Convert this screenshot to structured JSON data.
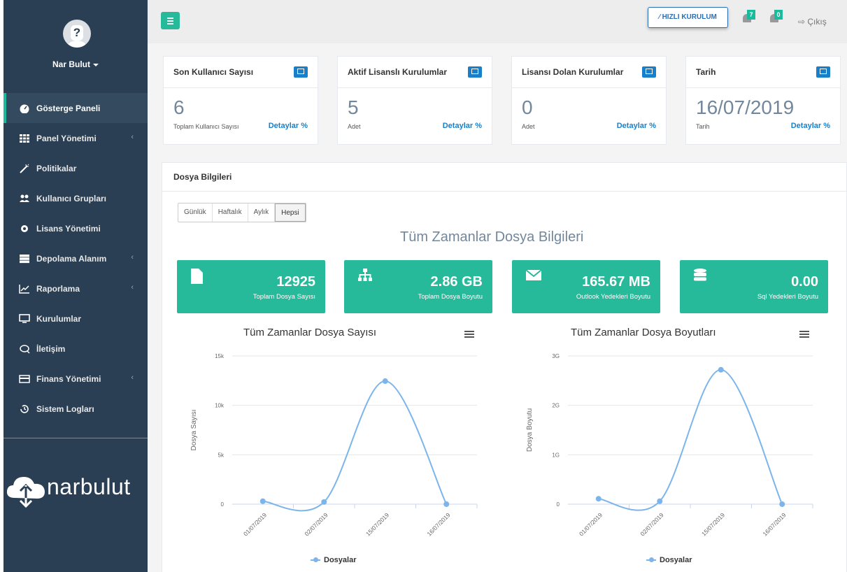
{
  "app": {
    "user_name": "Nar Bulut",
    "logo_text": "narbulut"
  },
  "sidebar": {
    "items": [
      {
        "label": "Gösterge Paneli",
        "icon": "dashboard-icon",
        "active": true
      },
      {
        "label": "Panel Yönetimi",
        "icon": "grid-icon",
        "submenu": true
      },
      {
        "label": "Politikalar",
        "icon": "magic-wand-icon"
      },
      {
        "label": "Kullanıcı Grupları",
        "icon": "users-icon"
      },
      {
        "label": "Lisans Yönetimi",
        "icon": "gear-icon"
      },
      {
        "label": "Depolama Alanım",
        "icon": "storage-icon",
        "submenu": true
      },
      {
        "label": "Raporlama",
        "icon": "chart-icon",
        "submenu": true
      },
      {
        "label": "Kurulumlar",
        "icon": "monitor-icon"
      },
      {
        "label": "İletişim",
        "icon": "comments-icon"
      },
      {
        "label": "Finans Yönetimi",
        "icon": "credit-card-icon",
        "submenu": true
      },
      {
        "label": "Sistem Logları",
        "icon": "history-icon"
      }
    ]
  },
  "topbar": {
    "quick_setup": "HIZLI KURULUM",
    "notif_count": "7",
    "user_notif_count": "0",
    "exit": "Çıkış"
  },
  "tiles": [
    {
      "title": "Son Kullanıcı Sayısı",
      "value": "6",
      "sub": "Toplam Kullanıcı Sayısı",
      "link": "Detaylar"
    },
    {
      "title": "Aktif Lisanslı Kurulumlar",
      "value": "5",
      "sub": "Adet",
      "link": "Detaylar"
    },
    {
      "title": "Lisansı Dolan Kurulumlar",
      "value": "0",
      "sub": "Adet",
      "link": "Detaylar"
    },
    {
      "title": "Tarih",
      "value": "16/07/2019",
      "sub": "Tarih",
      "link": "Detaylar"
    }
  ],
  "file_panel": {
    "title": "Dosya Bilgileri",
    "filters": [
      "Günlük",
      "Haftalık",
      "Aylık",
      "Hepsi"
    ],
    "selected_filter": "Hepsi",
    "heading": "Tüm Zamanlar Dosya Bilgileri",
    "stats": [
      {
        "value": "12925",
        "label": "Toplam Dosya Sayısı",
        "icon": "file-icon"
      },
      {
        "value": "2.86 GB",
        "label": "Toplam Dosya Boyutu",
        "icon": "sitemap-icon"
      },
      {
        "value": "165.67 MB",
        "label": "Outlook Yedekleri Boyutu",
        "icon": "envelope-icon"
      },
      {
        "value": "0.00",
        "label": "Sql Yedekleri Boyutu",
        "icon": "database-icon"
      }
    ]
  },
  "colors": {
    "sidebar": "#2a3f54",
    "accent": "#26b99a",
    "link": "#1a7fc9",
    "series": "#7cb5ec"
  },
  "chart_data": [
    {
      "type": "line",
      "title": "Tüm Zamanlar Dosya Sayısı",
      "ylabel": "Dosya Sayısı",
      "categories": [
        "01/07/2019",
        "02/07/2019",
        "15/07/2019",
        "16/07/2019"
      ],
      "y_ticks": [
        "0",
        "5k",
        "10k",
        "15k"
      ],
      "ylim": [
        0,
        15000
      ],
      "legend_position": "bottom",
      "series": [
        {
          "name": "Dosyalar",
          "values": [
            300,
            220,
            12450,
            0
          ]
        }
      ]
    },
    {
      "type": "line",
      "title": "Tüm Zamanlar Dosya Boyutları",
      "ylabel": "Dosya Boyutu",
      "categories": [
        "01/07/2019",
        "02/07/2019",
        "15/07/2019",
        "16/07/2019"
      ],
      "y_ticks": [
        "0",
        "1G",
        "2G",
        "3G"
      ],
      "ylim": [
        0,
        3
      ],
      "legend_position": "bottom",
      "series": [
        {
          "name": "Dosyalar",
          "values": [
            0.11,
            0.06,
            2.72,
            0
          ]
        }
      ]
    }
  ]
}
